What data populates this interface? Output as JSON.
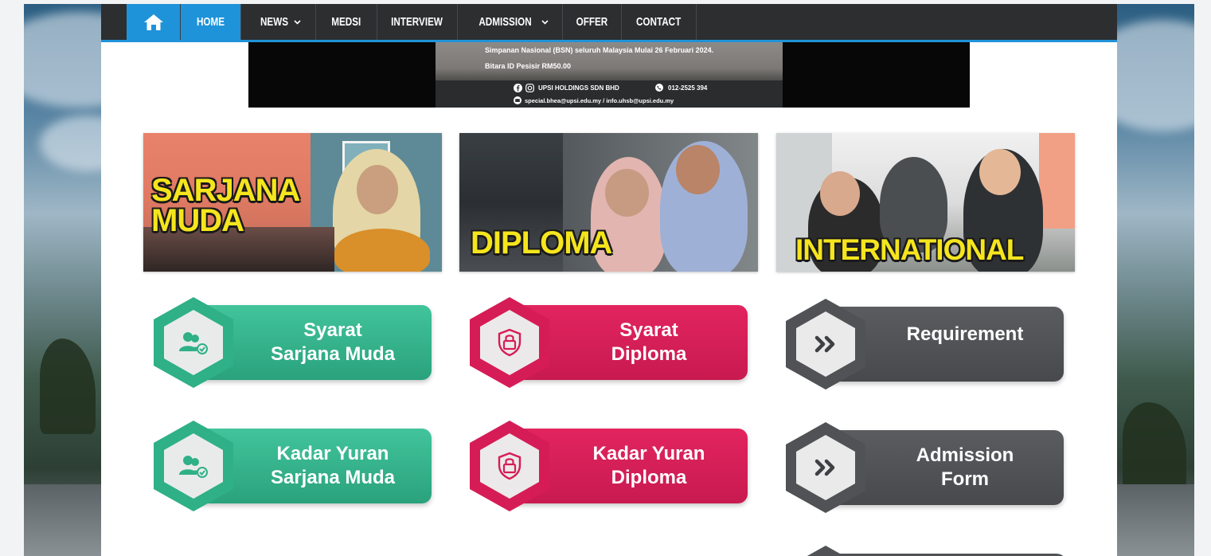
{
  "nav": {
    "home_icon": "home-icon",
    "items": [
      {
        "label": "HOME",
        "active": true
      },
      {
        "label": "NEWS",
        "dropdown": true
      },
      {
        "label": "MEDSI"
      },
      {
        "label": "INTERVIEW"
      },
      {
        "label": "ADMISSION",
        "dropdown": true
      },
      {
        "label": "OFFER"
      },
      {
        "label": "CONTACT"
      }
    ],
    "accent_color": "#1f93d9",
    "bar_color": "#2d2e30"
  },
  "banner": {
    "line1": "Simpanan Nasional (BSN) seluruh Malaysia Mulai 26 Februari 2024.",
    "line2": "Bitara ID Pesisir RM50.00",
    "company": "UPSI HOLDINGS SDN BHD",
    "phone": "012-2525 394",
    "email": "special.bhea@upsi.edu.my / info.uhsb@upsi.edu.my"
  },
  "cards": [
    {
      "title_line1": "SARJANA",
      "title_line2": "MUDA"
    },
    {
      "title_line1": "DIPLOMA"
    },
    {
      "title_line1": "INTERNATIONAL"
    }
  ],
  "buttons": [
    {
      "line1": "Syarat",
      "line2": "Sarjana Muda",
      "color": "#2fb087",
      "icon": "users-check-icon"
    },
    {
      "line1": "Syarat",
      "line2": "Diploma",
      "color": "#d61c56",
      "icon": "shield-lock-icon"
    },
    {
      "line1": "Requirement",
      "line2": "",
      "color": "#505255",
      "icon": "double-chevron-right-icon"
    },
    {
      "line1": "Kadar Yuran",
      "line2": "Sarjana Muda",
      "color": "#2fb087",
      "icon": "users-check-icon"
    },
    {
      "line1": "Kadar Yuran",
      "line2": "Diploma",
      "color": "#d61c56",
      "icon": "shield-lock-icon"
    },
    {
      "line1": "Admission",
      "line2": "Form",
      "color": "#505255",
      "icon": "double-chevron-right-icon"
    }
  ]
}
